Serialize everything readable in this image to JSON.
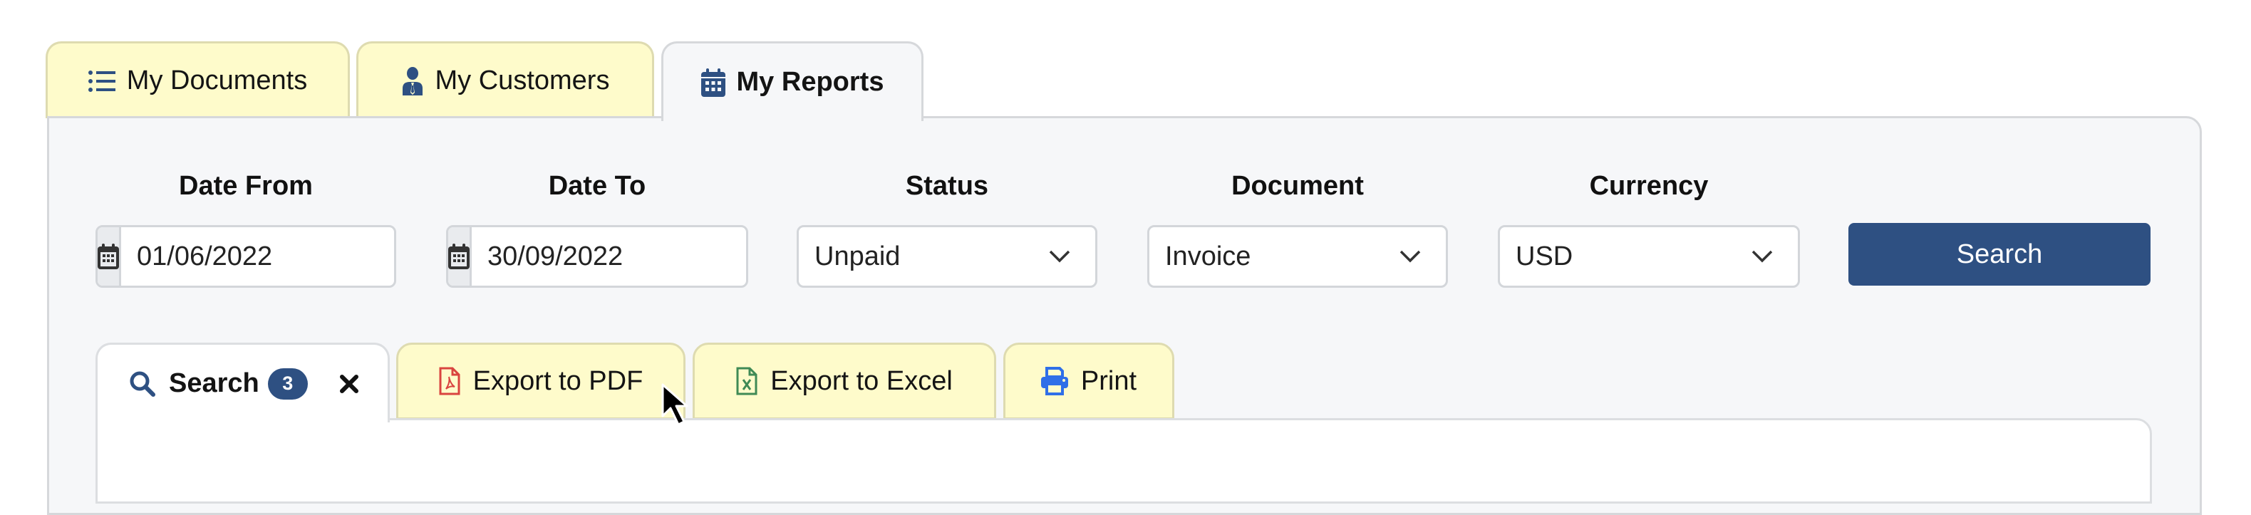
{
  "top_tabs": [
    {
      "label": "My Documents",
      "icon": "list-icon",
      "active": false
    },
    {
      "label": "My Customers",
      "icon": "user-tie-icon",
      "active": false
    },
    {
      "label": "My Reports",
      "icon": "calendar-icon",
      "active": true
    }
  ],
  "filters": {
    "date_from": {
      "label": "Date From",
      "value": "01/06/2022",
      "icon": "calendar-icon"
    },
    "date_to": {
      "label": "Date To",
      "value": "30/09/2022",
      "icon": "calendar-icon"
    },
    "status": {
      "label": "Status",
      "selected": "Unpaid"
    },
    "document": {
      "label": "Document",
      "selected": "Invoice"
    },
    "currency": {
      "label": "Currency",
      "selected": "USD"
    },
    "search_button": "Search"
  },
  "sub_tabs": {
    "search": {
      "label": "Search",
      "count": "3",
      "icon": "search-icon",
      "close_icon": "close-icon"
    },
    "export_pdf": {
      "label": "Export to PDF",
      "icon": "file-pdf-icon"
    },
    "export_excel": {
      "label": "Export to Excel",
      "icon": "file-excel-icon"
    },
    "print": {
      "label": "Print",
      "icon": "print-icon"
    }
  },
  "colors": {
    "primary": "#2e5082",
    "tab_inactive_bg": "#fefbcb",
    "panel_bg": "#f6f7f9",
    "pdf_red": "#d9443f",
    "excel_green": "#3f8a55",
    "print_blue": "#2f6fe8"
  }
}
